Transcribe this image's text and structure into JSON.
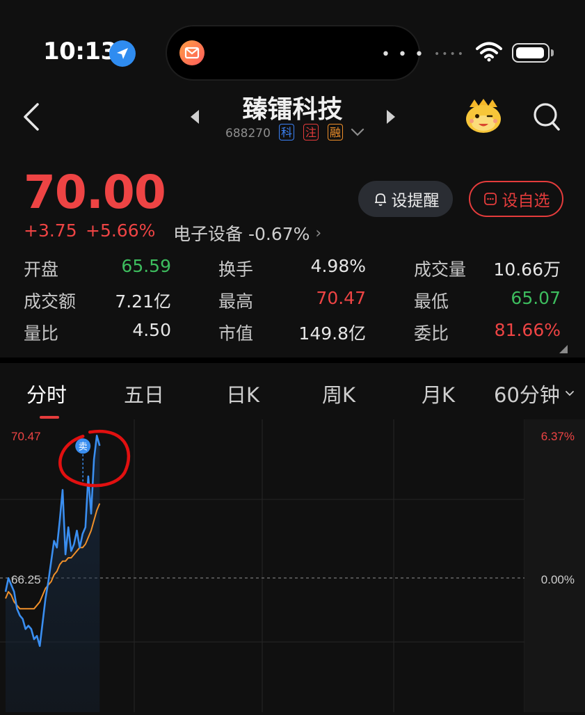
{
  "status_bar": {
    "time": "10:13",
    "location_icon": "location-arrow-icon",
    "notification_app_icon": "mail-app-icon",
    "more_icon": "ellipsis-icon",
    "signal_icon": "cellular-signal-icon",
    "wifi_icon": "wifi-icon",
    "battery_icon": "battery-icon"
  },
  "header": {
    "back_icon": "chevron-left-icon",
    "prev_icon": "triangle-left-icon",
    "next_icon": "triangle-right-icon",
    "stock_name": "臻镭科技",
    "stock_code": "688270",
    "tags": [
      {
        "label": "科",
        "color": "#3b82f6"
      },
      {
        "label": "注",
        "color": "#e53c3c"
      },
      {
        "label": "融",
        "color": "#f0902a"
      }
    ],
    "dropdown_icon": "chevron-down-icon",
    "mascot_icon": "mascot-icon",
    "search_icon": "search-icon"
  },
  "quote": {
    "price": "70.00",
    "change": "+3.75",
    "change_pct": "+5.66%",
    "sector": "电子设备 -0.67%",
    "sector_arrow": "›",
    "alert_button": "设提醒",
    "watchlist_button": "设自选",
    "stats": [
      [
        {
          "label": "开盘",
          "value": "65.59",
          "color": "#3dbd5e"
        },
        {
          "label": "换手",
          "value": "4.98%",
          "color": "#e6e6e6"
        },
        {
          "label": "成交量",
          "value": "10.66万",
          "color": "#e6e6e6"
        }
      ],
      [
        {
          "label": "成交额",
          "value": "7.21亿",
          "color": "#e6e6e6"
        },
        {
          "label": "最高",
          "value": "70.47",
          "color": "#ee4444"
        },
        {
          "label": "最低",
          "value": "65.07",
          "color": "#3dbd5e"
        }
      ],
      [
        {
          "label": "量比",
          "value": "4.50",
          "color": "#e6e6e6"
        },
        {
          "label": "市值",
          "value": "149.8亿",
          "color": "#e6e6e6"
        },
        {
          "label": "委比",
          "value": "81.66%",
          "color": "#ee4444"
        }
      ]
    ]
  },
  "tabs": [
    {
      "label": "分时",
      "active": true
    },
    {
      "label": "五日",
      "active": false
    },
    {
      "label": "日K",
      "active": false
    },
    {
      "label": "周K",
      "active": false
    },
    {
      "label": "月K",
      "active": false
    },
    {
      "label": "60分钟",
      "active": false,
      "dropdown": true
    }
  ],
  "colors": {
    "background": "#101010",
    "up": "#ee4444",
    "down": "#3dbd5e",
    "price_line": "#3a8ef0",
    "avg_line": "#f0902a",
    "sell_marker": "#3a8ef0",
    "annotation_circle": "#e11010"
  },
  "chart_data": {
    "type": "line",
    "y_max_label": "70.47",
    "y_prev_close_label": "66.25",
    "pct_max_label": "6.37%",
    "pct_zero_label": "0.00%",
    "ylim": [
      62.15,
      70.47
    ],
    "prev_close": 66.25,
    "marker_label": "卖",
    "series": [
      {
        "values": [
          65.7,
          66.1,
          65.9,
          65.7,
          65.2,
          65.0,
          64.9,
          64.6,
          64.7,
          64.6,
          64.3,
          64.4,
          64.1,
          64.8,
          65.5,
          66.0,
          66.6,
          67.2,
          67.0,
          67.8,
          68.7,
          66.8,
          67.6,
          66.9,
          67.1,
          67.5,
          67.0,
          67.4,
          67.6,
          69.1,
          68.0,
          69.6,
          70.3,
          70.0
        ]
      },
      {
        "values": [
          65.5,
          65.7,
          65.6,
          65.4,
          65.3,
          65.2,
          65.2,
          65.2,
          65.2,
          65.2,
          65.2,
          65.3,
          65.4,
          65.6,
          65.8,
          65.9,
          66.0,
          66.2,
          66.3,
          66.5,
          66.6,
          66.6,
          66.7,
          66.7,
          66.8,
          66.9,
          67.0,
          67.0,
          67.1,
          67.3,
          67.5,
          67.8,
          68.1,
          68.3
        ]
      }
    ]
  }
}
